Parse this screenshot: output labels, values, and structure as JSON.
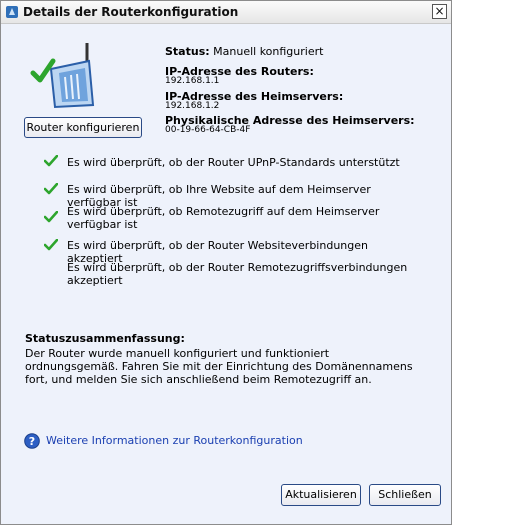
{
  "window": {
    "title": "Details der Routerkonfiguration",
    "close_label": "×"
  },
  "router_button_label": "Router konfigurieren",
  "status": {
    "label": "Status:",
    "value": "Manuell konfiguriert",
    "router_ip_label": "IP-Adresse des Routers:",
    "router_ip": "192.168.1.1",
    "server_ip_label": "IP-Adresse des Heimservers:",
    "server_ip": "192.168.1.2",
    "mac_label": "Physikalische Adresse des Heimservers:",
    "mac": "00-19-66-64-CB-4F"
  },
  "checks": [
    {
      "text": "Es wird überprüft, ob der Router UPnP-Standards unterstützt",
      "passed": true
    },
    {
      "text": "Es wird überprüft, ob Ihre Website auf dem Heimserver verfügbar ist",
      "passed": true
    },
    {
      "text": "Es wird überprüft, ob Remotezugriff auf dem Heimserver verfügbar ist",
      "passed": true
    },
    {
      "text": "Es wird überprüft, ob der Router Websiteverbindungen akzeptiert",
      "passed": true
    },
    {
      "text": "Es wird überprüft, ob der Router Remotezugriffsverbindungen akzeptiert",
      "passed": false
    }
  ],
  "summary": {
    "title": "Statuszusammenfassung:",
    "text": "Der Router wurde manuell konfiguriert und funktioniert ordnungsgemäß. Fahren Sie mit der Einrichtung des Domänennamens fort, und melden Sie sich anschließend beim Remotezugriff an."
  },
  "help_link": "Weitere Informationen zur Routerkonfiguration",
  "buttons": {
    "refresh": "Aktualisieren",
    "close": "Schließen"
  },
  "colors": {
    "background": "#eef2fb",
    "check_green": "#2da52d",
    "link_blue": "#1a3fb1"
  }
}
